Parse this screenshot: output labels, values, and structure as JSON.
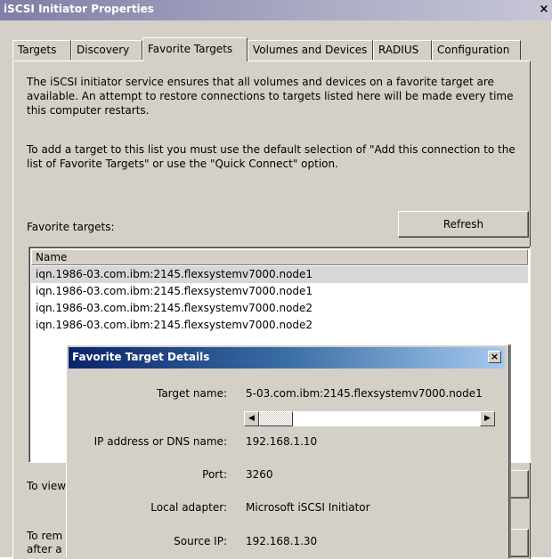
{
  "window": {
    "title": "iSCSI Initiator Properties",
    "close_glyph": "×"
  },
  "tabs": [
    {
      "label": "Targets"
    },
    {
      "label": "Discovery"
    },
    {
      "label": "Favorite Targets"
    },
    {
      "label": "Volumes and Devices"
    },
    {
      "label": "RADIUS"
    },
    {
      "label": "Configuration"
    }
  ],
  "panel": {
    "intro": "The iSCSI initiator service ensures that all volumes and devices on a favorite target are available.  An attempt to restore connections to targets listed here will be made every time this computer restarts.",
    "instructions": "To add a target to this list you must use the default selection of \"Add this connection to the list of Favorite Targets\" or use the \"Quick Connect\" option.",
    "list_label": "Favorite targets:",
    "refresh_label": "Refresh",
    "column_header": "Name",
    "targets": [
      "iqn.1986-03.com.ibm:2145.flexsystemv7000.node1",
      "iqn.1986-03.com.ibm:2145.flexsystemv7000.node1",
      "iqn.1986-03.com.ibm:2145.flexsystemv7000.node2",
      "iqn.1986-03.com.ibm:2145.flexsystemv7000.node2"
    ],
    "view_text_partial": "To view",
    "remove_text_partial_1": "To rem",
    "remove_text_partial_2": "after a"
  },
  "dialog": {
    "title": "Favorite Target Details",
    "close_glyph": "×",
    "scroll_left_glyph": "◀",
    "scroll_right_glyph": "▶",
    "fields": {
      "target_name_label": "Target name:",
      "target_name_value": "5-03.com.ibm:2145.flexsystemv7000.node1",
      "ip_label": "IP address or DNS name:",
      "ip_value": "192.168.1.10",
      "port_label": "Port:",
      "port_value": "3260",
      "adapter_label": "Local adapter:",
      "adapter_value": "Microsoft iSCSI Initiator",
      "source_ip_label": "Source IP:",
      "source_ip_value": "192.168.1.30"
    }
  }
}
